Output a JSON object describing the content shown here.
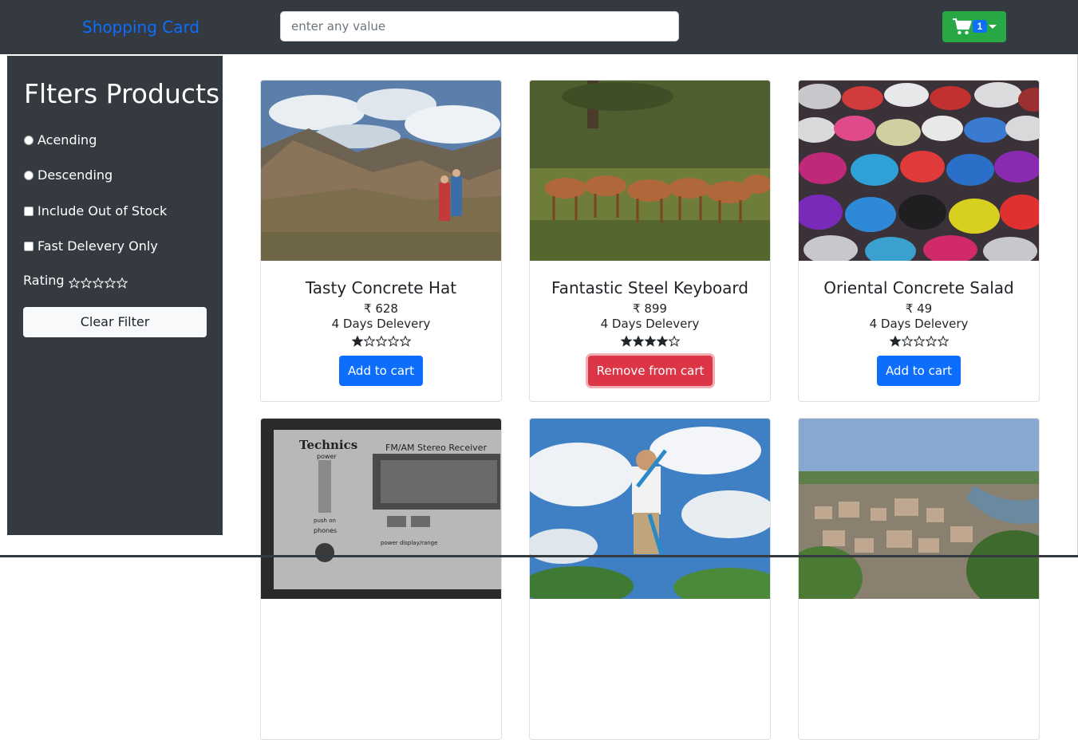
{
  "navbar": {
    "brand": "Shopping Card",
    "search_placeholder": "enter any value",
    "cart_count": "1"
  },
  "sidebar": {
    "title": "Flters Products",
    "options": [
      {
        "type": "radio",
        "label": "Acending"
      },
      {
        "type": "radio",
        "label": "Descending"
      },
      {
        "type": "checkbox",
        "label": "Include Out of Stock"
      },
      {
        "type": "checkbox",
        "label": "Fast Delevery Only"
      }
    ],
    "rating_label": "Rating",
    "rating_value": 0,
    "rating_max": 5,
    "clear_label": "Clear Filter"
  },
  "products": [
    {
      "title": "Tasty Concrete Hat",
      "price": "₹ 628",
      "delivery": "4 Days Delevery",
      "rating": 1,
      "button": "Add to cart",
      "button_kind": "add",
      "image": "mountain-hikers-photo"
    },
    {
      "title": "Fantastic Steel Keyboard",
      "price": "₹ 899",
      "delivery": "4 Days Delevery",
      "rating": 4,
      "button": "Remove from cart",
      "button_kind": "remove",
      "image": "impala-herd-photo"
    },
    {
      "title": "Oriental Concrete Salad",
      "price": "₹ 49",
      "delivery": "4 Days Delevery",
      "rating": 1,
      "button": "Add to cart",
      "button_kind": "add",
      "image": "sneakers-pile-photo"
    },
    {
      "title": "",
      "price": "",
      "delivery": "",
      "image": "stereo-receiver-photo",
      "image_text": {
        "brand": "Technics",
        "model": "FM/AM Stereo Receiver",
        "power": "power",
        "push_on": "push on",
        "phones": "phones",
        "display": "power display/range"
      }
    },
    {
      "title": "",
      "price": "",
      "delivery": "",
      "image": "boy-scooter-photo"
    },
    {
      "title": "",
      "price": "",
      "delivery": "",
      "image": "city-river-aerial-photo"
    }
  ],
  "colors": {
    "navbar_bg": "#343a40",
    "brand": "#0d6efd",
    "cart_button": "#28a745",
    "add_button": "#0d6efd",
    "remove_button": "#dc3545"
  }
}
